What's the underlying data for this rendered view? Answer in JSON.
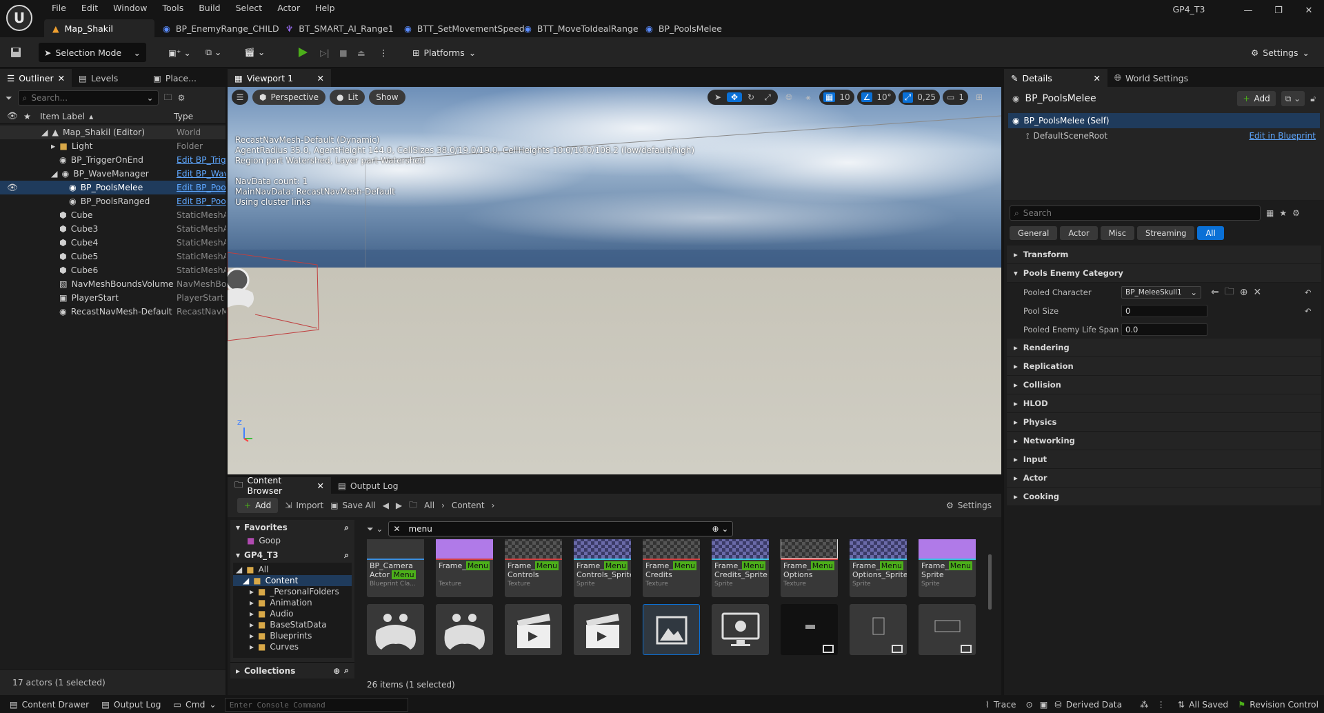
{
  "app": {
    "menu": [
      "File",
      "Edit",
      "Window",
      "Tools",
      "Build",
      "Select",
      "Actor",
      "Help"
    ],
    "project_name": "GP4_T3",
    "doc_tabs": [
      "Map_Shakil",
      "BP_EnemyRange_CHILD",
      "BT_SMART_AI_Range1",
      "BTT_SetMovementSpeed",
      "BTT_MoveToIdealRange",
      "BP_PoolsMelee"
    ]
  },
  "toolbar": {
    "mode": "Selection Mode",
    "platforms": "Platforms",
    "settings": "Settings"
  },
  "outliner": {
    "tabs": [
      "Outliner",
      "Levels",
      "Place..."
    ],
    "search_placeholder": "Search...",
    "col_label": "Item Label",
    "col_type": "Type",
    "rows": [
      {
        "label": "Map_Shakil (Editor)",
        "type": "World"
      },
      {
        "label": "Light",
        "type": "Folder"
      },
      {
        "label": "BP_TriggerOnEnd",
        "type": "Edit BP_Trig"
      },
      {
        "label": "BP_WaveManager",
        "type": "Edit BP_Wav"
      },
      {
        "label": "BP_PoolsMelee",
        "type": "Edit BP_Poo"
      },
      {
        "label": "BP_PoolsRanged",
        "type": "Edit BP_Poo"
      },
      {
        "label": "Cube",
        "type": "StaticMeshA"
      },
      {
        "label": "Cube3",
        "type": "StaticMeshA"
      },
      {
        "label": "Cube4",
        "type": "StaticMeshA"
      },
      {
        "label": "Cube5",
        "type": "StaticMeshA"
      },
      {
        "label": "Cube6",
        "type": "StaticMeshA"
      },
      {
        "label": "NavMeshBoundsVolume",
        "type": "NavMeshBo"
      },
      {
        "label": "PlayerStart",
        "type": "PlayerStart"
      },
      {
        "label": "RecastNavMesh-Default",
        "type": "RecastNavM"
      }
    ],
    "footer": "17 actors (1 selected)"
  },
  "viewport": {
    "tab": "Viewport 1",
    "perspective": "Perspective",
    "lit": "Lit",
    "show": "Show",
    "grid_snap": "10",
    "rot_snap": "10°",
    "scale_snap": "0,25",
    "cam_speed": "1",
    "overlay": [
      "RecastNavMesh-Default (Dynamic)",
      "AgentRadius 35.0, AgentHeight 144.0, CellSizes 38.0/19.0/19.0, CellHeights 10.0/10.0/108.2 (low/default/high)",
      "Region part Watershed, Layer part Watershed",
      "",
      "NavData count: 1",
      "MainNavData: RecastNavMesh-Default",
      "Using cluster links"
    ],
    "axis_z": "Z"
  },
  "details": {
    "tabs": [
      "Details",
      "World Settings"
    ],
    "title": "BP_PoolsMelee",
    "add": "Add",
    "self": "BP_PoolsMelee (Self)",
    "root": "DefaultSceneRoot",
    "edit_bp": "Edit in Blueprint",
    "search_placeholder": "Search",
    "filters": [
      "General",
      "Actor",
      "Misc",
      "Streaming",
      "All"
    ],
    "sections_top": [
      "Transform"
    ],
    "category": "Pools Enemy Category",
    "props": [
      {
        "name": "Pooled Character",
        "value": "BP_MeleeSkull1"
      },
      {
        "name": "Pool Size",
        "value": "0"
      },
      {
        "name": "Pooled Enemy Life Span",
        "value": "0.0"
      }
    ],
    "sections": [
      "Rendering",
      "Replication",
      "Collision",
      "HLOD",
      "Physics",
      "Networking",
      "Input",
      "Actor",
      "Cooking"
    ]
  },
  "content_browser": {
    "tabs": [
      "Content Browser",
      "Output Log"
    ],
    "add": "Add",
    "import": "Import",
    "save_all": "Save All",
    "path": [
      "All",
      "Content"
    ],
    "settings": "Settings",
    "favorites": "Favorites",
    "fav_items": [
      "Goop"
    ],
    "project": "GP4_T3",
    "tree": [
      "All",
      "Content",
      "_PersonalFolders",
      "Animation",
      "Audio",
      "BaseStatData",
      "Blueprints",
      "Curves"
    ],
    "collections": "Collections",
    "search_value": "menu",
    "status": "26 items (1 selected)",
    "tiles": [
      {
        "pre": "BP_Camera",
        "hl": "",
        "post": "",
        "line2pre": "Actor ",
        "line2hl": "Menu",
        "type": "Blueprint Cla..."
      },
      {
        "pre": "Frame_",
        "hl": "Menu",
        "post": "",
        "line2pre": "",
        "line2hl": "",
        "type": "Texture"
      },
      {
        "pre": "Frame_",
        "hl": "Menu",
        "post": "",
        "line2pre": "Controls",
        "line2hl": "",
        "type": "Texture"
      },
      {
        "pre": "Frame_",
        "hl": "Menu",
        "post": "",
        "line2pre": "Controls_Sprite",
        "line2hl": "",
        "type": "Sprite"
      },
      {
        "pre": "Frame_",
        "hl": "Menu",
        "post": "",
        "line2pre": "Credits",
        "line2hl": "",
        "type": "Texture"
      },
      {
        "pre": "Frame_",
        "hl": "Menu",
        "post": "",
        "line2pre": "Credits_Sprite",
        "line2hl": "",
        "type": "Sprite"
      },
      {
        "pre": "Frame_",
        "hl": "Menu",
        "post": "",
        "line2pre": "Options",
        "line2hl": "",
        "type": "Texture"
      },
      {
        "pre": "Frame_",
        "hl": "Menu",
        "post": "",
        "line2pre": "Options_Sprite",
        "line2hl": "",
        "type": "Sprite"
      },
      {
        "pre": "Frame_",
        "hl": "Menu",
        "post": "",
        "line2pre": "Sprite",
        "line2hl": "",
        "type": "Sprite"
      }
    ]
  },
  "statusbar": {
    "content_drawer": "Content Drawer",
    "output_log": "Output Log",
    "cmd": "Cmd",
    "console_placeholder": "Enter Console Command",
    "trace": "Trace",
    "derived_data": "Derived Data",
    "all_saved": "All Saved",
    "revision": "Revision Control"
  },
  "colors": {
    "accent": "#0a70d6",
    "selection": "#1f3b5c",
    "highlight": "#4caf1a",
    "link": "#5ea7ff"
  }
}
